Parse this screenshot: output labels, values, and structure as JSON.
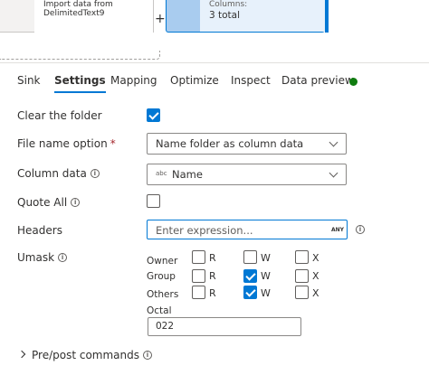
{
  "canvas": {
    "source_node": {
      "line1": "Import data from",
      "line2": "DelimitedText9"
    },
    "plus": "+",
    "sink_node": {
      "label": "Columns:",
      "value": "3 total"
    }
  },
  "tabs": [
    {
      "label": "Sink",
      "active": false
    },
    {
      "label": "Settings",
      "active": true
    },
    {
      "label": "Mapping",
      "active": false
    },
    {
      "label": "Optimize",
      "active": false
    },
    {
      "label": "Inspect",
      "active": false
    },
    {
      "label": "Data preview",
      "active": false
    }
  ],
  "status_color": "#107c10",
  "accent_color": "#0078d4",
  "form": {
    "clear_folder": {
      "label": "Clear the folder",
      "checked": true
    },
    "file_name_option": {
      "label": "File name option",
      "required_mark": "*",
      "value": "Name folder as column data"
    },
    "column_data": {
      "label": "Column data",
      "type_badge": "abc",
      "value": "Name"
    },
    "quote_all": {
      "label": "Quote All",
      "checked": false
    },
    "headers": {
      "label": "Headers",
      "placeholder": "Enter expression...",
      "badge": "ANY"
    },
    "umask": {
      "label": "Umask",
      "rows": [
        {
          "name": "Owner",
          "r": false,
          "w": false,
          "x": false
        },
        {
          "name": "Group",
          "r": false,
          "w": true,
          "x": false
        },
        {
          "name": "Others",
          "r": false,
          "w": true,
          "x": false
        }
      ],
      "perm_labels": {
        "r": "R",
        "w": "W",
        "x": "X"
      },
      "octal_label": "Octal",
      "octal_value": "022"
    },
    "pre_post": {
      "label": "Pre/post commands"
    }
  },
  "icons": {
    "info": "info-icon",
    "chevron": "chevron-down-icon",
    "expander": "chevron-right-icon"
  }
}
